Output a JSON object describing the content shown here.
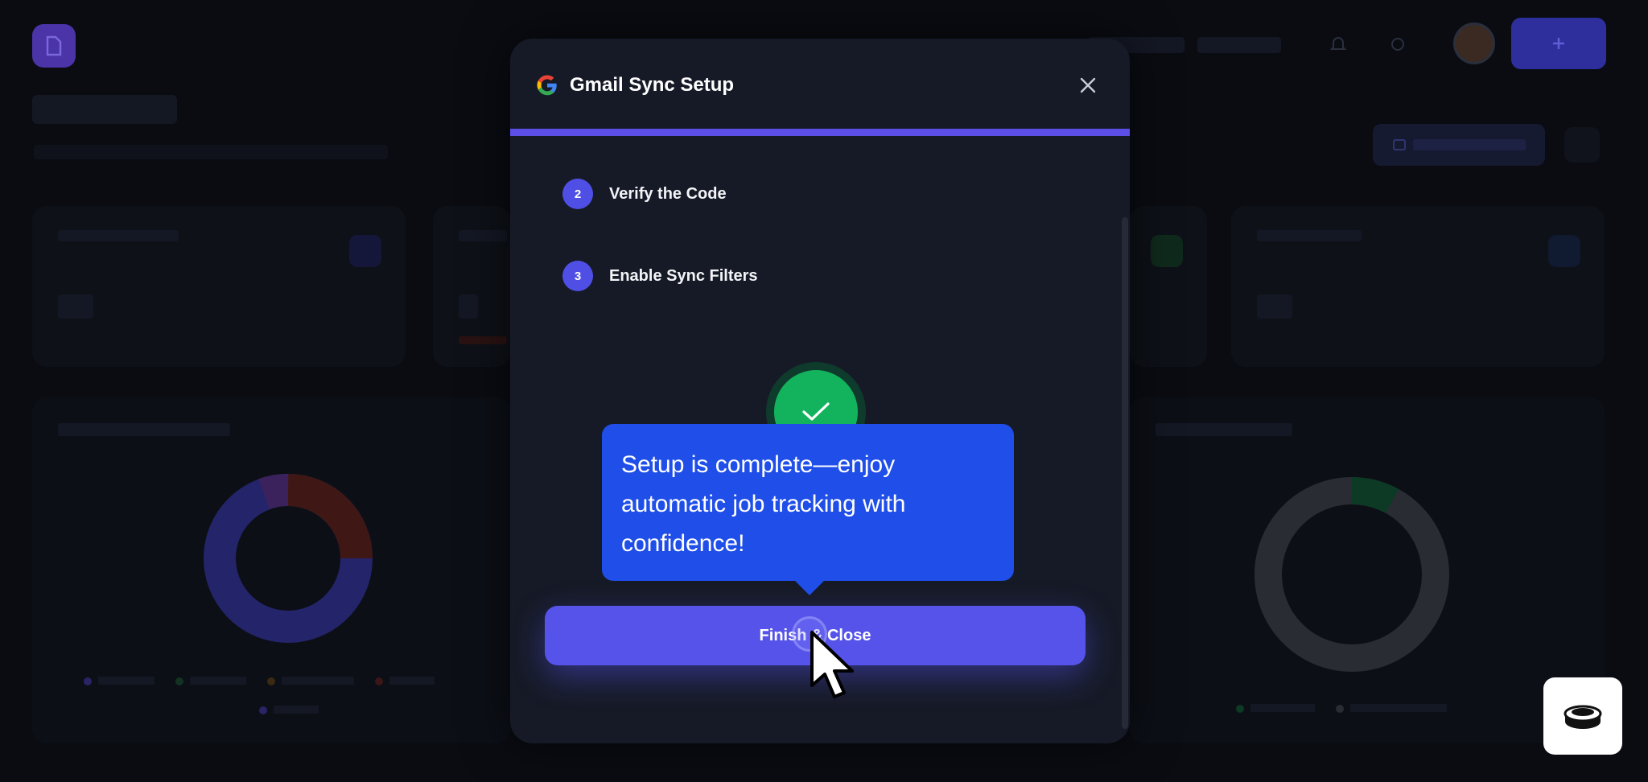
{
  "modal": {
    "title": "Gmail Sync Setup",
    "progress_pct": 100,
    "steps": [
      {
        "number": "2",
        "label": "Verify the Code"
      },
      {
        "number": "3",
        "label": "Enable Sync Filters"
      }
    ],
    "finish_button": "Finish & Close"
  },
  "tooltip": {
    "text": "Setup is complete—enjoy automatic job tracking with confidence!"
  },
  "colors": {
    "accent": "#5553ea",
    "success": "#13b35d",
    "tooltip": "#1f4ee8",
    "modal_bg": "#161a26"
  },
  "icons": {
    "close": "close-icon",
    "google": "google-g-icon",
    "check": "check-icon",
    "cursor": "mouse-pointer-icon",
    "widget": "button-stack-icon"
  }
}
